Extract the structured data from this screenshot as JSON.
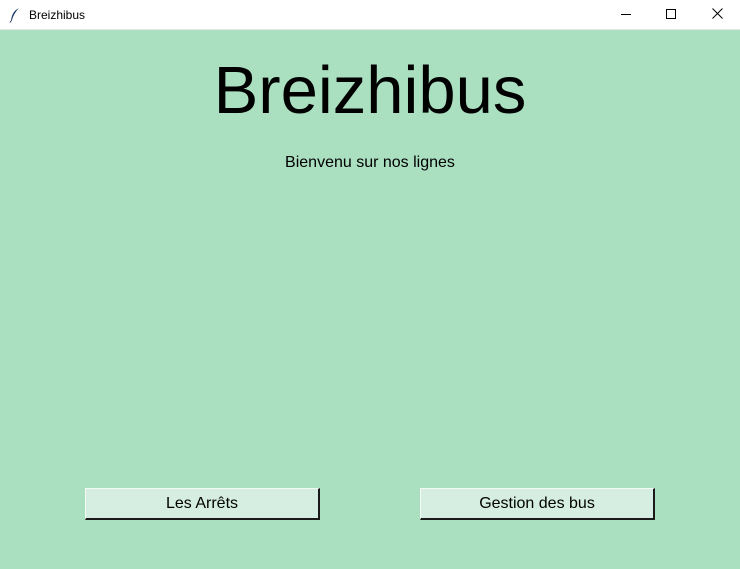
{
  "window": {
    "title": "Breizhibus",
    "icon": "feather-icon"
  },
  "colors": {
    "background": "#aadfc0",
    "button_face": "#d6eee1",
    "titlebar": "#ffffff"
  },
  "main": {
    "title": "Breizhibus",
    "subtitle": "Bienvenu sur nos lignes"
  },
  "buttons": {
    "arrets_label": "Les Arrêts",
    "gestion_label": "Gestion des bus"
  }
}
